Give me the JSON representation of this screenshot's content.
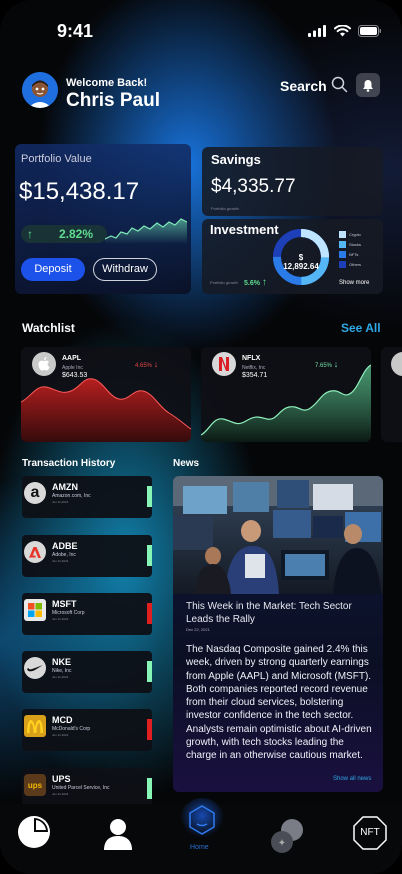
{
  "status": {
    "time": "9:41"
  },
  "header": {
    "welcome": "Welcome Back!",
    "user_name": "Chris Paul",
    "search_label": "Search"
  },
  "portfolio": {
    "label": "Portfolio Value",
    "value": "$15,438.17",
    "growth": "2.82%",
    "deposit_label": "Deposit",
    "withdraw_label": "Withdraw"
  },
  "savings": {
    "label": "Savings",
    "value": "$4,335.77",
    "sublabel": "Portfolio growth"
  },
  "investment": {
    "label": "Investment",
    "total": "$ 12,892.64",
    "sublabel": "Portfolio growth",
    "growth": "5.6%",
    "legend": [
      {
        "label": "Crypto",
        "color": "#bfe4ff"
      },
      {
        "label": "Stocks",
        "color": "#55b6f5"
      },
      {
        "label": "NFTs",
        "color": "#2a7be8"
      },
      {
        "label": "Others",
        "color": "#1d3fb8"
      }
    ],
    "show_more": "Show more"
  },
  "watchlist": {
    "title": "Watchlist",
    "see_all": "See All",
    "items": [
      {
        "symbol": "AAPL",
        "name": "Apple Inc",
        "price": "$643.53",
        "change": "4.65%",
        "direction": "down",
        "color": "#e04848"
      },
      {
        "symbol": "NFLX",
        "name": "Netflix, Inc",
        "price": "$354.71",
        "change": "7.65%",
        "direction": "up",
        "color": "#74e0a6"
      }
    ]
  },
  "transactions": {
    "title": "Transaction History",
    "items": [
      {
        "symbol": "AMZN",
        "name": "Amazon.com, Inc",
        "date": "Jun 11,2024",
        "status_color": "#86f5b5",
        "logo": "a"
      },
      {
        "symbol": "ADBE",
        "name": "Adobe, Inc",
        "date": "Jun 11,2024",
        "status_color": "#86f5b5",
        "logo": "A"
      },
      {
        "symbol": "MSFT",
        "name": "Microsoft Corp",
        "date": "Jun 11,2024",
        "status_color": "#e02020",
        "logo": "ms"
      },
      {
        "symbol": "NKE",
        "name": "Nike, Inc",
        "date": "Jun 11,2024",
        "status_color": "#86f5b5",
        "logo": "✓"
      },
      {
        "symbol": "MCD",
        "name": "McDonald's Corp",
        "date": "Jun 11,2024",
        "status_color": "#e02020",
        "logo": "M"
      },
      {
        "symbol": "UPS",
        "name": "United Parcel Service, Inc",
        "date": "Jun 11,2024",
        "status_color": "#86f5b5",
        "logo": "ups"
      }
    ]
  },
  "news": {
    "title": "News",
    "headline": "This Week in the Market: Tech Sector Leads the Rally",
    "date": "Dec 22, 2021",
    "body": "The Nasdaq Composite gained 2.4% this week, driven by strong quarterly earnings from Apple (AAPL) and Microsoft (MSFT). Both companies reported record revenue from their cloud services, bolstering investor confidence in the tech sector. Analysts remain optimistic about AI-driven growth, with tech stocks leading the charge in an otherwise cautious market.",
    "show_all": "Show all news"
  },
  "tabbar": {
    "home_label": "Home",
    "nft_label": "NFT"
  }
}
